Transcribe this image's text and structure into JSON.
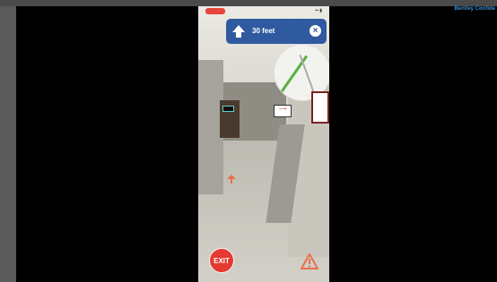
{
  "header": {
    "brand": "Bentley Confide"
  },
  "nav": {
    "distance": "30 feet",
    "arrow_icon": "arrow-up-icon",
    "close_icon": "close-icon"
  },
  "status": {
    "indicator": "red-pill",
    "right": "▪▪ ▮"
  },
  "scene": {
    "panel_label": "⟶"
  },
  "controls": {
    "exit_label": "EXIT",
    "warning_icon": "warning-icon"
  },
  "colors": {
    "nav_bg": "#2f5aa0",
    "exit_red": "#e53a32",
    "brand_blue": "#3b8fd6"
  }
}
